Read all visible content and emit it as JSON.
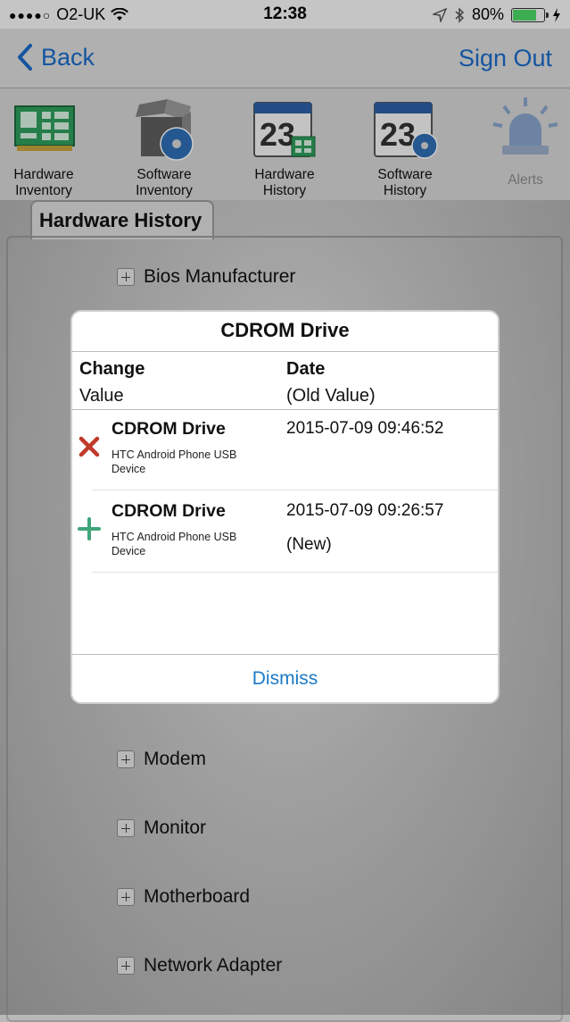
{
  "status": {
    "carrier": "O2-UK",
    "time": "12:38",
    "battery": "80%",
    "battery_level": 0.8
  },
  "nav": {
    "back": "Back",
    "signout": "Sign Out"
  },
  "toolbar": {
    "items": [
      {
        "line1": "Hardware",
        "line2": "Inventory",
        "icon": "circuit-board-icon"
      },
      {
        "line1": "Software",
        "line2": "Inventory",
        "icon": "software-box-icon"
      },
      {
        "line1": "Hardware",
        "line2": "History",
        "icon": "calendar-hardware-icon"
      },
      {
        "line1": "Software",
        "line2": "History",
        "icon": "calendar-software-icon"
      },
      {
        "line1": "Alerts",
        "line2": "",
        "icon": "alert-siren-icon"
      }
    ]
  },
  "panel": {
    "tab": "Hardware History",
    "items": [
      "Bios Manufacturer",
      "Modem",
      "Monitor",
      "Motherboard",
      "Network Adapter"
    ]
  },
  "modal": {
    "title": "CDROM Drive",
    "col1_h1": "Change",
    "col1_h2": "Value",
    "col2_h1": "Date",
    "col2_h2": "(Old Value)",
    "rows": [
      {
        "type": "removed",
        "name": "CDROM Drive",
        "detail": "HTC Android Phone USB Device",
        "date": "2015-07-09 09:46:52",
        "old": ""
      },
      {
        "type": "added",
        "name": "CDROM Drive",
        "detail": "HTC Android Phone USB Device",
        "date": "2015-07-09 09:26:57",
        "old": "(New)"
      }
    ],
    "dismiss": "Dismiss"
  },
  "colors": {
    "accent": "#1a6bc9",
    "removed": "#c0392b",
    "added": "#3fa57a"
  }
}
